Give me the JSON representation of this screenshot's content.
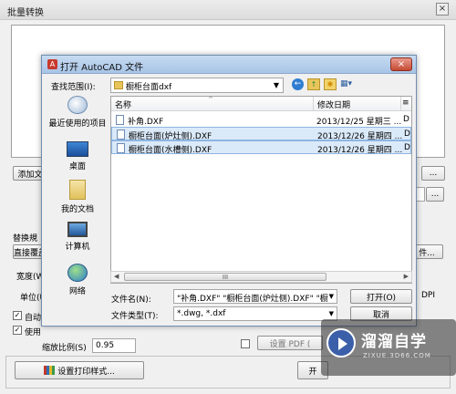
{
  "background_window": {
    "title": "批量转换",
    "close_label": "×",
    "add_file_button": "添加文",
    "more_button_1": "...",
    "more_button_2": "...",
    "more_button_3": "件...",
    "replace_label": "替换規",
    "direct_cover_label": "直接覆盖",
    "width_label": "宽度(W",
    "unit_label": "单位(U",
    "dpi_label": "DPI",
    "auto_label": "自动",
    "use_label": "使用",
    "scale_label": "缩放比例(S)",
    "scale_value": "0.95",
    "set_pdf_label": "设置 PDF (",
    "print_style_button": "设置打印样式...",
    "start_button": "开"
  },
  "dialog": {
    "title": "打开 AutoCAD 文件",
    "close_label": "×",
    "lookin_label": "查找范围(I):",
    "lookin_value": "橱柜台面dxf",
    "places": [
      {
        "label": "最近使用的项目",
        "icon": "recent-items-icon"
      },
      {
        "label": "桌面",
        "icon": "desktop-icon"
      },
      {
        "label": "我的文档",
        "icon": "my-documents-icon"
      },
      {
        "label": "计算机",
        "icon": "computer-icon"
      },
      {
        "label": "网络",
        "icon": "network-icon"
      }
    ],
    "columns": {
      "name": "名称",
      "date": "修改日期",
      "extra": "≡"
    },
    "files": [
      {
        "name": "补角.DXF",
        "date": "2013/12/25 星期三 ...",
        "extra": "D"
      },
      {
        "name": "橱柜台面(炉灶侧).DXF",
        "date": "2013/12/26 星期四 ...",
        "extra": "D"
      },
      {
        "name": "橱柜台面(水槽侧).DXF",
        "date": "2013/12/26 星期四 ...",
        "extra": "D"
      }
    ],
    "scroll_thumb_label": "III",
    "filename_label": "文件名(N):",
    "filename_value": "\"补角.DXF\" \"橱柜台面(炉灶侧).DXF\" \"橱",
    "filetype_label": "文件类型(T):",
    "filetype_value": "*.dwg, *.dxf",
    "open_button": "打开(O)",
    "cancel_button": "取消"
  },
  "watermark": {
    "brand": "溜溜自学",
    "url": "ZIXUE.3D66.COM"
  }
}
